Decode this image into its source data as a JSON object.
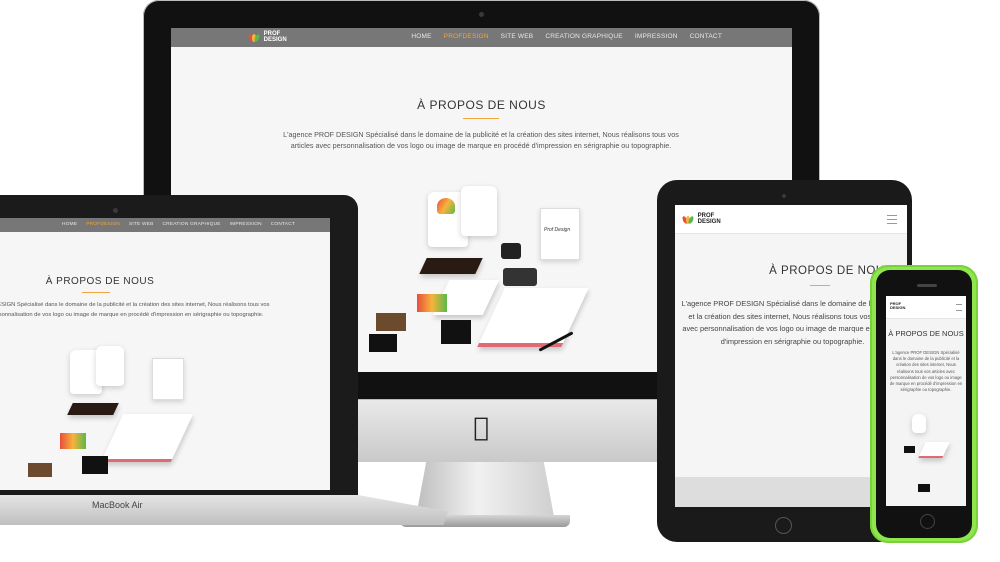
{
  "site": {
    "brand_line1": "PROF",
    "brand_line2": "DESIGN",
    "nav": [
      "HOME",
      "PROFDESIGN",
      "SITE WEB",
      "CREATION GRAPHIQUE",
      "IMPRESSION",
      "CONTACT"
    ],
    "active_nav": "PROFDESIGN",
    "heading": "À PROPOS DE NOUS",
    "paragraph": "L'agence PROF DESIGN Spécialisé dans le domaine de la publicité et la création des sites internet, Nous réalisons tous vos articles avec personnalisation de vos logo ou image de marque en procédé d'impression en sérigraphie ou topographie.",
    "bag_label": "Prof Design"
  },
  "devices": {
    "laptop_label": "MacBook Air"
  },
  "colors": {
    "accent": "#f3a43b",
    "nav_bg": "#777777",
    "iphone_shell": "#8ee54c"
  }
}
